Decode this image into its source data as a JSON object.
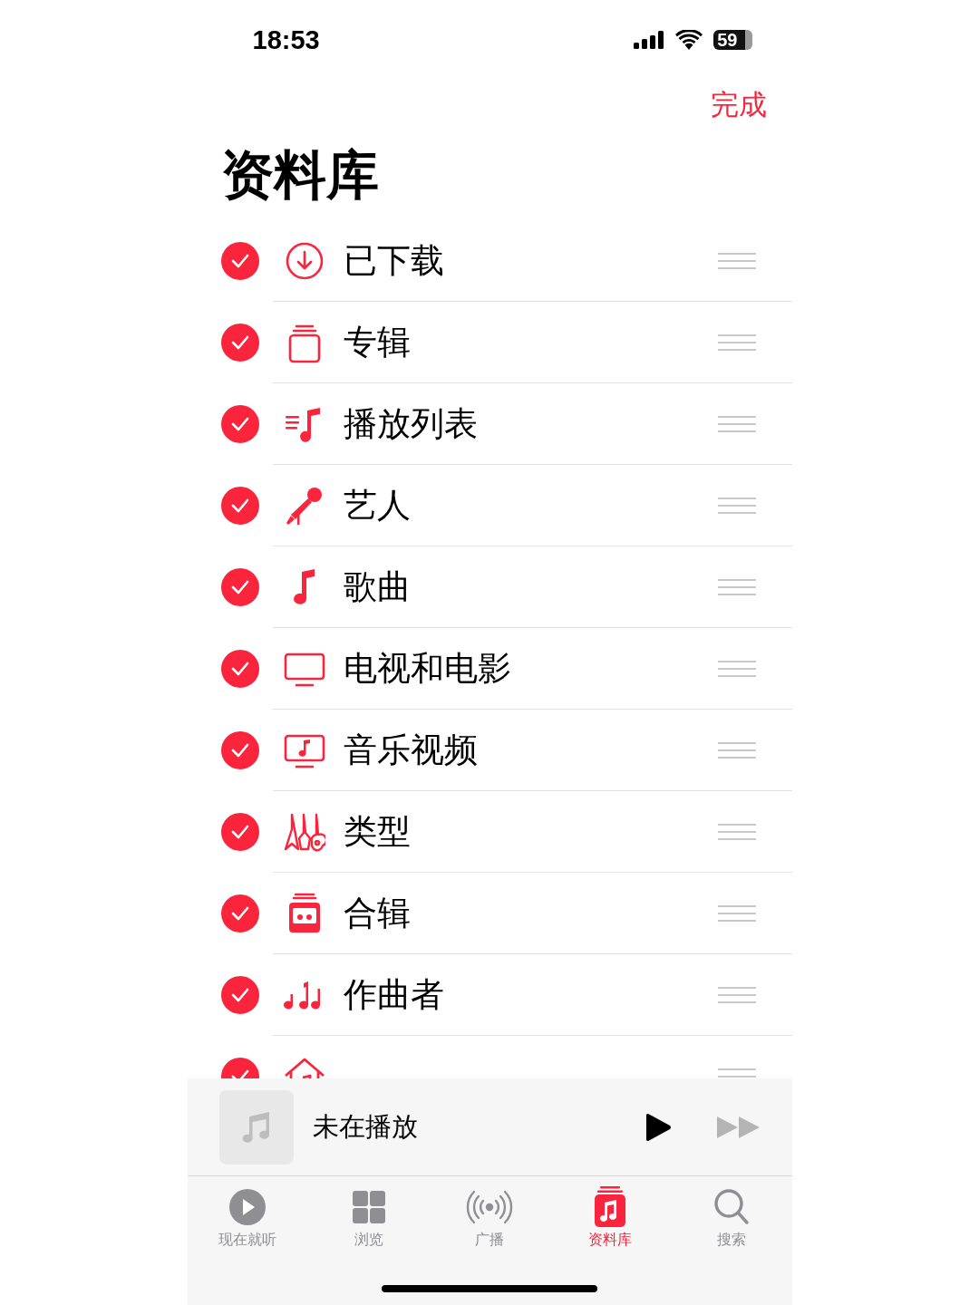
{
  "status_bar": {
    "time": "18:53",
    "battery": "59"
  },
  "nav": {
    "done": "完成"
  },
  "title": "资料库",
  "items": [
    {
      "label": "已下载",
      "kind": "download",
      "checked": true
    },
    {
      "label": "专辑",
      "kind": "album",
      "checked": true
    },
    {
      "label": "播放列表",
      "kind": "playlist",
      "checked": true
    },
    {
      "label": "艺人",
      "kind": "artist",
      "checked": true
    },
    {
      "label": "歌曲",
      "kind": "song",
      "checked": true
    },
    {
      "label": "电视和电影",
      "kind": "tv",
      "checked": true
    },
    {
      "label": "音乐视频",
      "kind": "music-video",
      "checked": true
    },
    {
      "label": "类型",
      "kind": "genre",
      "checked": true
    },
    {
      "label": "合辑",
      "kind": "compilation",
      "checked": true
    },
    {
      "label": "作曲者",
      "kind": "composer",
      "checked": true
    },
    {
      "kind": "home",
      "checked": true
    }
  ],
  "mini_player": {
    "title": "未在播放"
  },
  "tabs": [
    {
      "label": "现在就听",
      "kind": "listen-now",
      "selected": false
    },
    {
      "label": "浏览",
      "kind": "browse",
      "selected": false
    },
    {
      "label": "广播",
      "kind": "radio",
      "selected": false
    },
    {
      "label": "资料库",
      "kind": "library",
      "selected": true
    },
    {
      "label": "搜索",
      "kind": "search",
      "selected": false
    }
  ]
}
